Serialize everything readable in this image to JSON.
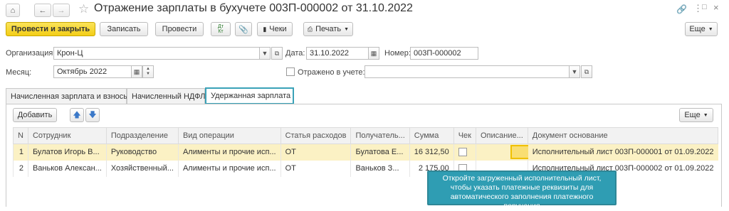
{
  "window": {
    "title": "Отражение зарплаты в бухучете 003П-000002 от 31.10.2022"
  },
  "toolbar": {
    "post_close": "Провести и закрыть",
    "save": "Записать",
    "post": "Провести",
    "checks": "Чеки",
    "print": "Печать",
    "more": "Еще"
  },
  "form": {
    "org_label": "Организация:",
    "org_value": "Крон-Ц",
    "date_label": "Дата:",
    "date_value": "31.10.2022",
    "number_label": "Номер:",
    "number_value": "003П-000002",
    "month_label": "Месяц:",
    "month_value": "Октябрь 2022",
    "reflected_label": "Отражено в учете:",
    "reflected_value": ""
  },
  "tabs": [
    "Начисленная зарплата и взносы",
    "Начисленный НДФЛ",
    "Удержанная зарплата"
  ],
  "table": {
    "add": "Добавить",
    "more": "Еще",
    "columns": [
      "N",
      "Сотрудник",
      "Подразделение",
      "Вид операции",
      "Статья расходов",
      "Получатель...",
      "Сумма",
      "Чек",
      "Описание...",
      "Документ основание"
    ],
    "rows": [
      [
        "1",
        "Булатов Игорь В...",
        "Руководство",
        "Алименты и прочие исп...",
        "ОТ",
        "Булатова Е...",
        "16 312,50",
        "",
        "",
        "Исполнительный лист 003П-000001 от 01.09.2022"
      ],
      [
        "2",
        "Ваньков Алексан...",
        "Хозяйственный...",
        "Алименты и прочие исп...",
        "ОТ",
        "Ваньков З...",
        "2 175,00",
        "",
        "",
        "Исполнительный лист 003П-000002 от 01.09.2022"
      ]
    ]
  },
  "callout": "Откройте загруженный исполнительный лист, чтобы указать платежные реквизиты для автоматического заполнения платежного поручения",
  "colors": {
    "primary": "#f3cd16",
    "accent": "#2f9db3",
    "selected_row": "#fbf1c4"
  }
}
